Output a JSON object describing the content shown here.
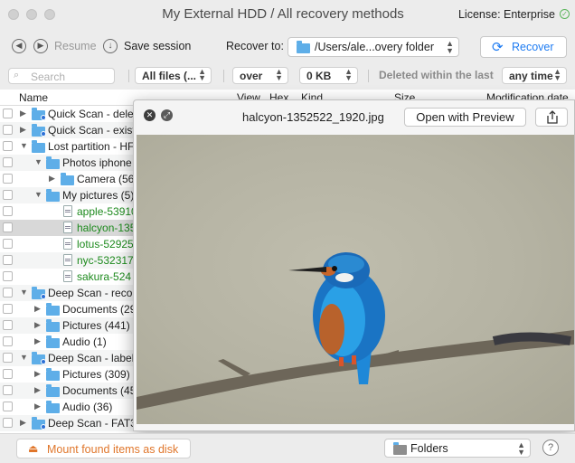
{
  "window": {
    "title": "My External HDD / All recovery methods",
    "license": "License: Enterprise"
  },
  "toolbar": {
    "resume": "Resume",
    "save_session": "Save session",
    "recover_to_label": "Recover to:",
    "recover_to_path": "/Users/ale...overy folder",
    "recover_button": "Recover"
  },
  "filters": {
    "search_placeholder": "Search",
    "file_type": "All files (...",
    "size_comparator": "over",
    "size_value": "0 KB",
    "deleted_label": "Deleted within the last",
    "time_range": "any time"
  },
  "table": {
    "columns": [
      "Name",
      "View",
      "Hex",
      "Kind",
      "Size",
      "Modification date"
    ],
    "rows": [
      {
        "label": "Quick Scan - dele",
        "level": 0,
        "type": "scan",
        "disclosure": "closed"
      },
      {
        "label": "Quick Scan - exist",
        "level": 0,
        "type": "scan",
        "disclosure": "closed"
      },
      {
        "label": "Lost partition - HF",
        "level": 0,
        "type": "folder",
        "disclosure": "open"
      },
      {
        "label": "Photos iphone",
        "level": 1,
        "type": "folder",
        "disclosure": "open"
      },
      {
        "label": "Camera (56",
        "level": 2,
        "type": "folder",
        "disclosure": "closed"
      },
      {
        "label": "My pictures (5)",
        "level": 1,
        "type": "folder",
        "disclosure": "open"
      },
      {
        "label": "apple-53910",
        "level": 2,
        "type": "file",
        "disclosure": "none"
      },
      {
        "label": "halcyon-135",
        "level": 2,
        "type": "file",
        "disclosure": "none",
        "selected": true
      },
      {
        "label": "lotus-52925",
        "level": 2,
        "type": "file",
        "disclosure": "none"
      },
      {
        "label": "nyc-532317",
        "level": 2,
        "type": "file",
        "disclosure": "none"
      },
      {
        "label": "sakura-524",
        "level": 2,
        "type": "file",
        "disclosure": "none"
      },
      {
        "label": "Deep Scan - reco",
        "level": 0,
        "type": "scan",
        "disclosure": "open"
      },
      {
        "label": "Documents (29",
        "level": 1,
        "type": "folder",
        "disclosure": "closed"
      },
      {
        "label": "Pictures (441)",
        "level": 1,
        "type": "folder",
        "disclosure": "closed"
      },
      {
        "label": "Audio (1)",
        "level": 1,
        "type": "folder",
        "disclosure": "closed"
      },
      {
        "label": "Deep Scan - label",
        "level": 0,
        "type": "scan",
        "disclosure": "open"
      },
      {
        "label": "Pictures (309)",
        "level": 1,
        "type": "folder",
        "disclosure": "closed"
      },
      {
        "label": "Documents (45",
        "level": 1,
        "type": "folder",
        "disclosure": "closed"
      },
      {
        "label": "Audio (36)",
        "level": 1,
        "type": "folder",
        "disclosure": "closed"
      },
      {
        "label": "Deep Scan - FAT3",
        "level": 0,
        "type": "scan",
        "disclosure": "closed"
      }
    ]
  },
  "quicklook": {
    "filename": "halcyon-1352522_1920.jpg",
    "open_with": "Open with Preview"
  },
  "bottom": {
    "mount": "Mount found items as disk",
    "view_mode": "Folders",
    "help": "?"
  },
  "colors": {
    "accent": "#1f7cf2",
    "recovered_file": "#1d8a1d",
    "mount": "#e0762b",
    "folder": "#5eaee8"
  }
}
